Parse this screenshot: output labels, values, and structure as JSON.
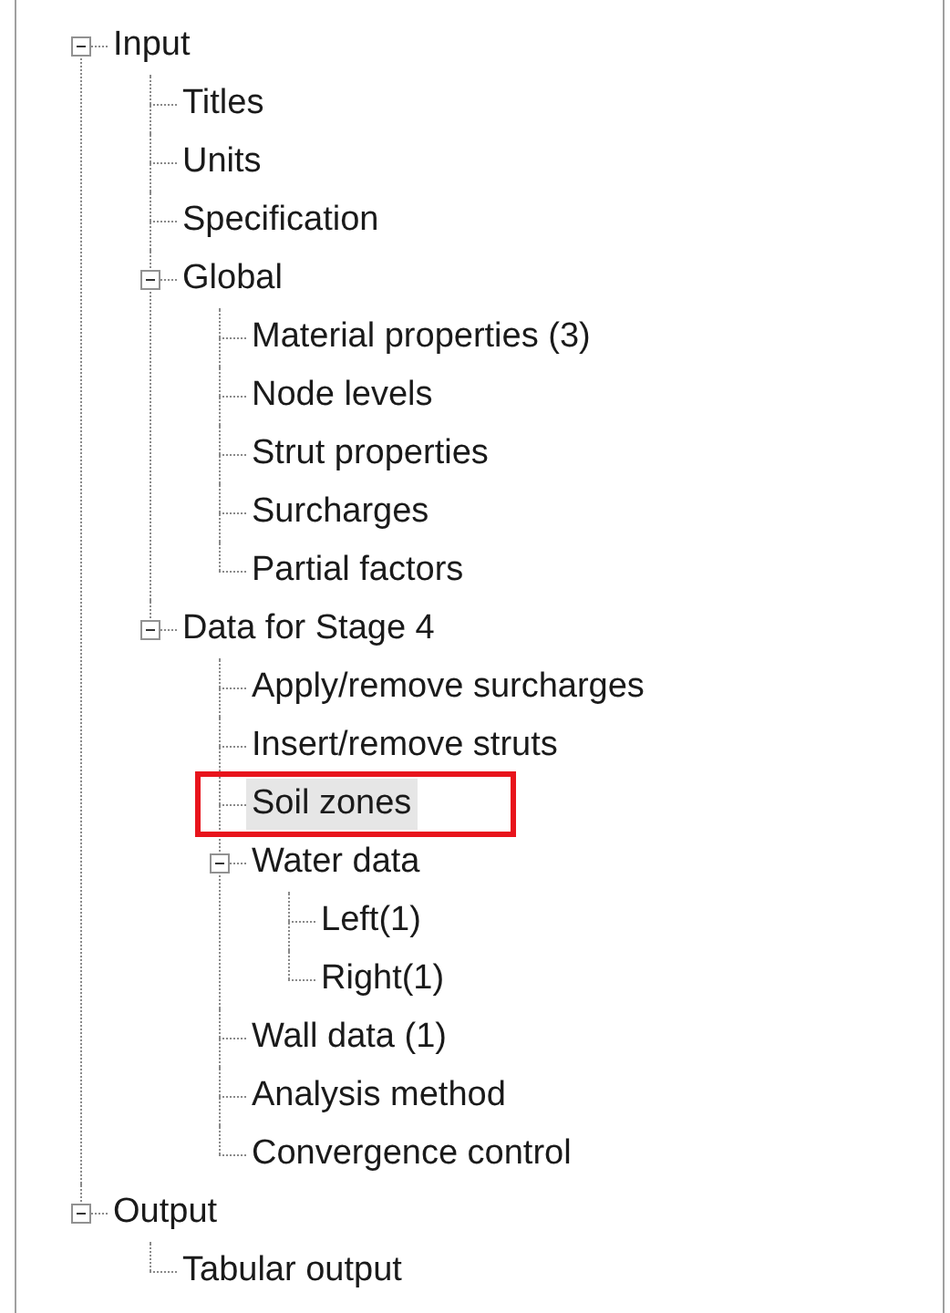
{
  "tree": [
    {
      "label": "Input",
      "expanded": true,
      "children": [
        {
          "label": "Titles",
          "selected": false
        },
        {
          "label": "Units",
          "selected": false
        },
        {
          "label": "Specification",
          "selected": false
        },
        {
          "label": "Global",
          "expanded": true,
          "selected": false,
          "children": [
            {
              "label": "Material properties (3)",
              "selected": false
            },
            {
              "label": "Node levels",
              "selected": false
            },
            {
              "label": "Strut properties",
              "selected": false
            },
            {
              "label": "Surcharges",
              "selected": false
            },
            {
              "label": "Partial factors",
              "selected": false
            }
          ]
        },
        {
          "label": "Data for Stage 4",
          "expanded": true,
          "selected": false,
          "children": [
            {
              "label": "Apply/remove surcharges",
              "selected": false
            },
            {
              "label": "Insert/remove struts",
              "selected": false
            },
            {
              "label": "Soil zones",
              "selected": true,
              "annotated": true
            },
            {
              "label": "Water data",
              "expanded": true,
              "selected": false,
              "children": [
                {
                  "label": "Left(1)",
                  "selected": false
                },
                {
                  "label": "Right(1)",
                  "selected": false
                }
              ]
            },
            {
              "label": "Wall data (1)",
              "selected": false
            },
            {
              "label": "Analysis method",
              "selected": false
            },
            {
              "label": "Convergence control",
              "selected": false
            }
          ]
        }
      ],
      "selected": false
    },
    {
      "label": "Output",
      "expanded": true,
      "selected": false,
      "children": [
        {
          "label": "Tabular output",
          "selected": false
        }
      ]
    }
  ]
}
